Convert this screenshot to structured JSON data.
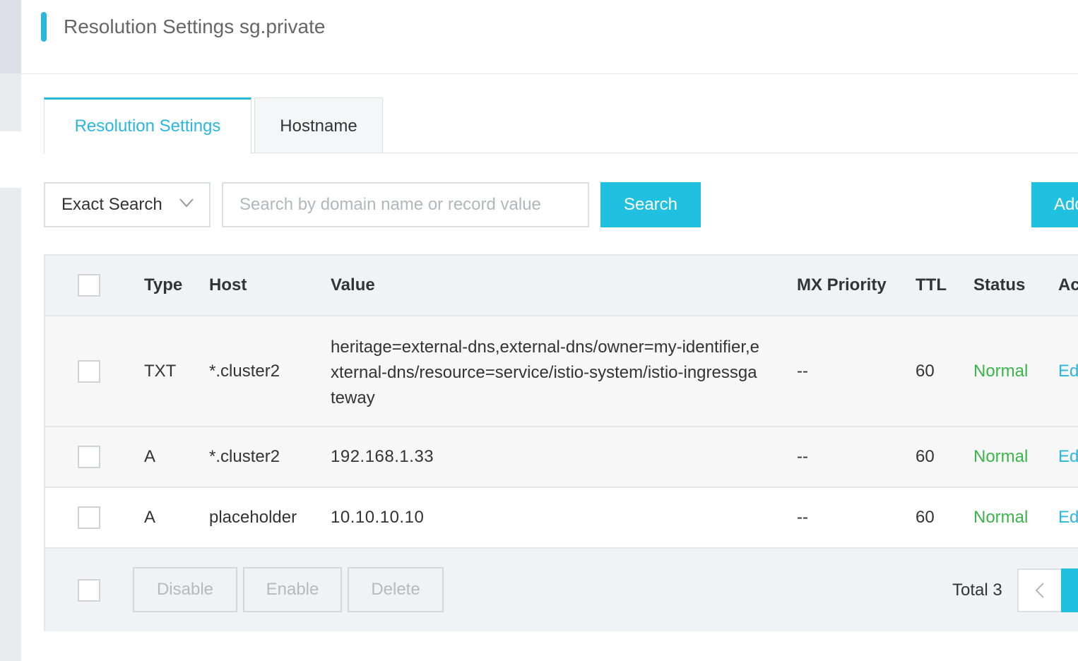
{
  "header": {
    "title": "Resolution Settings sg.private"
  },
  "tabs": [
    {
      "label": "Resolution Settings",
      "active": true
    },
    {
      "label": "Hostname",
      "active": false
    }
  ],
  "toolbar": {
    "search_type": "Exact Search",
    "search_placeholder": "Search by domain name or record value",
    "search_value": "",
    "search_label": "Search",
    "add_label": "Add"
  },
  "table": {
    "columns": [
      "Type",
      "Host",
      "Value",
      "MX Priority",
      "TTL",
      "Status",
      "Ac"
    ],
    "rows": [
      {
        "type": "TXT",
        "host": "*.cluster2",
        "value": "heritage=external-dns,external-dns/owner=my-identifier,external-dns/resource=service/istio-system/istio-ingressgateway",
        "mx": "--",
        "ttl": "60",
        "status": "Normal",
        "action": "Ed"
      },
      {
        "type": "A",
        "host": "*.cluster2",
        "value": "192.168.1.33",
        "mx": "--",
        "ttl": "60",
        "status": "Normal",
        "action": "Ed"
      },
      {
        "type": "A",
        "host": "placeholder",
        "value": "10.10.10.10",
        "mx": "--",
        "ttl": "60",
        "status": "Normal",
        "action": "Ed"
      }
    ]
  },
  "footer": {
    "disable_label": "Disable",
    "enable_label": "Enable",
    "delete_label": "Delete",
    "total_label": "Total 3"
  },
  "colors": {
    "accent": "#29b7e0",
    "primary_button": "#1fc0e0",
    "status_normal": "#3ab54a"
  },
  "icons": {
    "select_chevron": "chevron-down-icon",
    "pager_prev": "chevron-left-icon"
  }
}
